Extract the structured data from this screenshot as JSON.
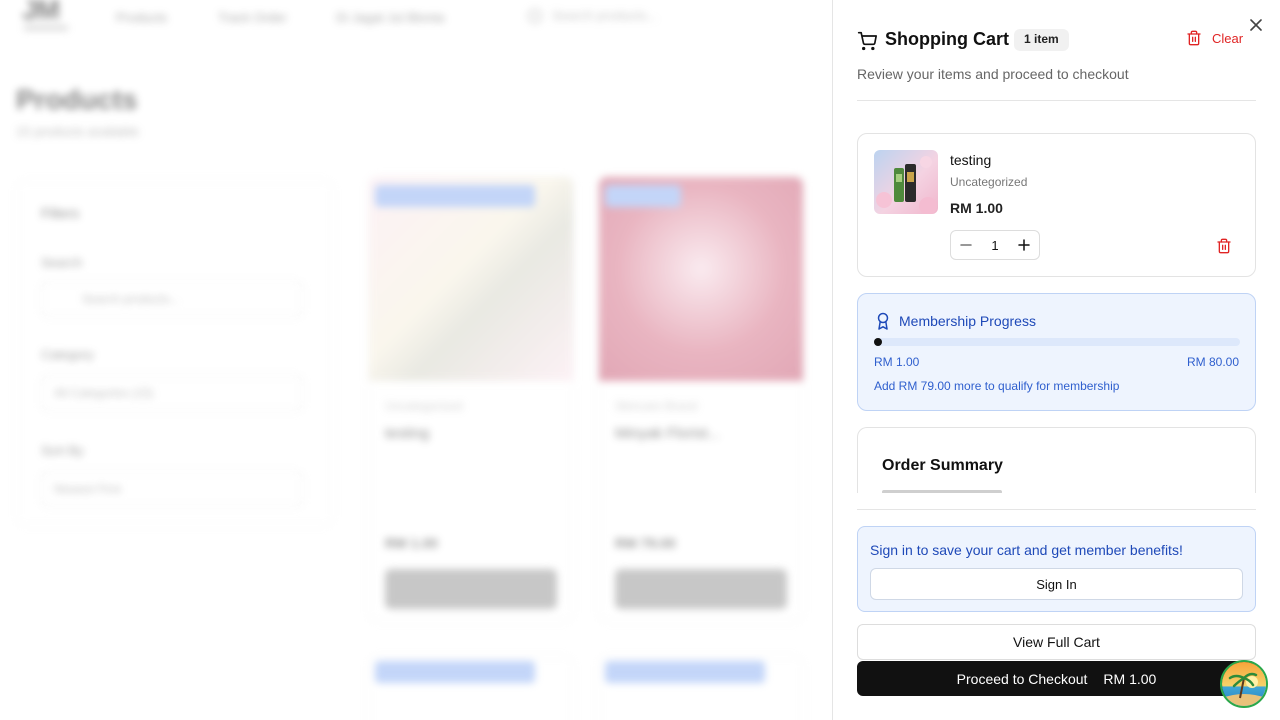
{
  "background": {
    "logo_text": "JM",
    "nav": [
      "Products",
      "Track Order",
      "Di Jagat Jul Blonta"
    ],
    "search_placeholder": "Search products...",
    "page_title": "Products",
    "product_count": "15 products available",
    "filters": {
      "title": "Filters",
      "search_label": "Search",
      "search_placeholder": "Search products...",
      "category_label": "Category",
      "category_value": "All Categories (15)",
      "sort_label": "Sort By",
      "sort_value": "Newest First"
    },
    "cards": [
      {
        "category": "Uncategorized",
        "name": "testing",
        "price": "RM 1.00",
        "button": "Add to Cart"
      },
      {
        "category": "Skincare Brand",
        "name": "Minyak Florist...",
        "price": "RM 79.00",
        "button": "Add to Cart"
      }
    ]
  },
  "cart": {
    "title": "Shopping Cart",
    "count_badge": "1 item",
    "clear_label": "Clear",
    "subtitle": "Review your items and proceed to checkout",
    "items": [
      {
        "name": "testing",
        "category": "Uncategorized",
        "price": "RM 1.00",
        "quantity": "1"
      }
    ],
    "membership": {
      "title": "Membership Progress",
      "current": "RM 1.00",
      "target": "RM 80.00",
      "progress_percent": 1.25,
      "note": "Add RM 79.00 more to qualify for membership"
    },
    "summary_title": "Order Summary",
    "signin_message": "Sign in to save your cart and get member benefits!",
    "signin_button": "Sign In",
    "view_cart_button": "View Full Cart",
    "checkout_label": "Proceed to Checkout",
    "checkout_total": "RM 1.00"
  },
  "colors": {
    "accent_blue": "#1e49b8",
    "danger_red": "#e02424",
    "checkout_bg": "#111111"
  },
  "icons": {
    "close": "close-icon",
    "cart": "cart-icon",
    "clear": "trash-icon",
    "membership": "award-icon",
    "minus": "minus-icon",
    "plus": "plus-icon"
  }
}
